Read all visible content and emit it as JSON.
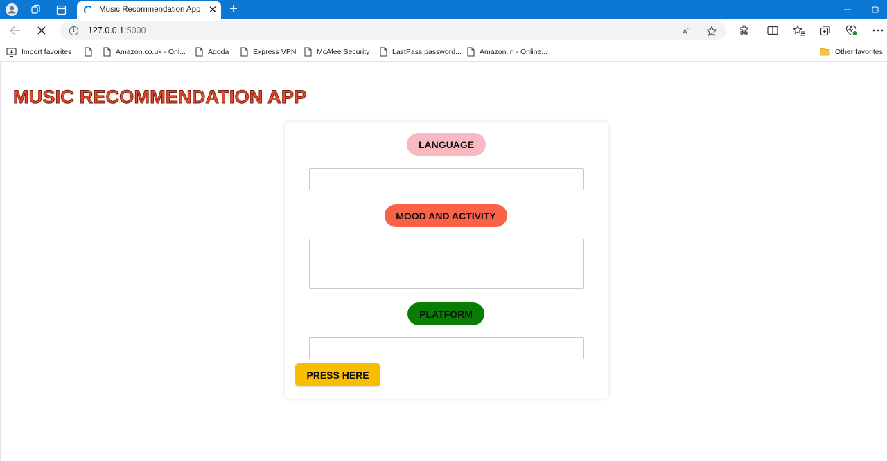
{
  "browser": {
    "tab_title": "Music Recommendation App",
    "url_host": "127.0.0.1",
    "url_port": ":5000"
  },
  "favorites": {
    "items": [
      "Import favorites",
      "Amazon.co.uk - Onl...",
      "Agoda",
      "Express VPN",
      "McAfee Security",
      "LastPass password...",
      "Amazon.in - Online..."
    ],
    "other": "Other favorites"
  },
  "app": {
    "title": "MUSIC RECOMMENDATION APP",
    "language_label": "LANGUAGE",
    "mood_label": "MOOD AND ACTIVITY",
    "platform_label": "PLATFORM",
    "language_value": "",
    "mood_value": "",
    "platform_value": "",
    "submit_label": "PRESS HERE"
  },
  "colors": {
    "chrome_blue": "#0a78d4",
    "title_red": "#e34b2c",
    "language_pill": "#f8b9c2",
    "mood_pill": "#f96247",
    "platform_pill": "#0a7d05",
    "button_yellow": "#f9bd04"
  },
  "icons": {
    "titlebar": [
      "profile-icon",
      "workspaces-icon",
      "tab-actions-icon"
    ],
    "toolbar": [
      "back-icon",
      "stop-loading-icon",
      "site-info-icon",
      "read-aloud-icon",
      "add-favorite-icon",
      "extensions-icon",
      "split-screen-icon",
      "favorites-icon",
      "collections-icon",
      "browser-essentials-icon",
      "more-menu-icon"
    ]
  }
}
